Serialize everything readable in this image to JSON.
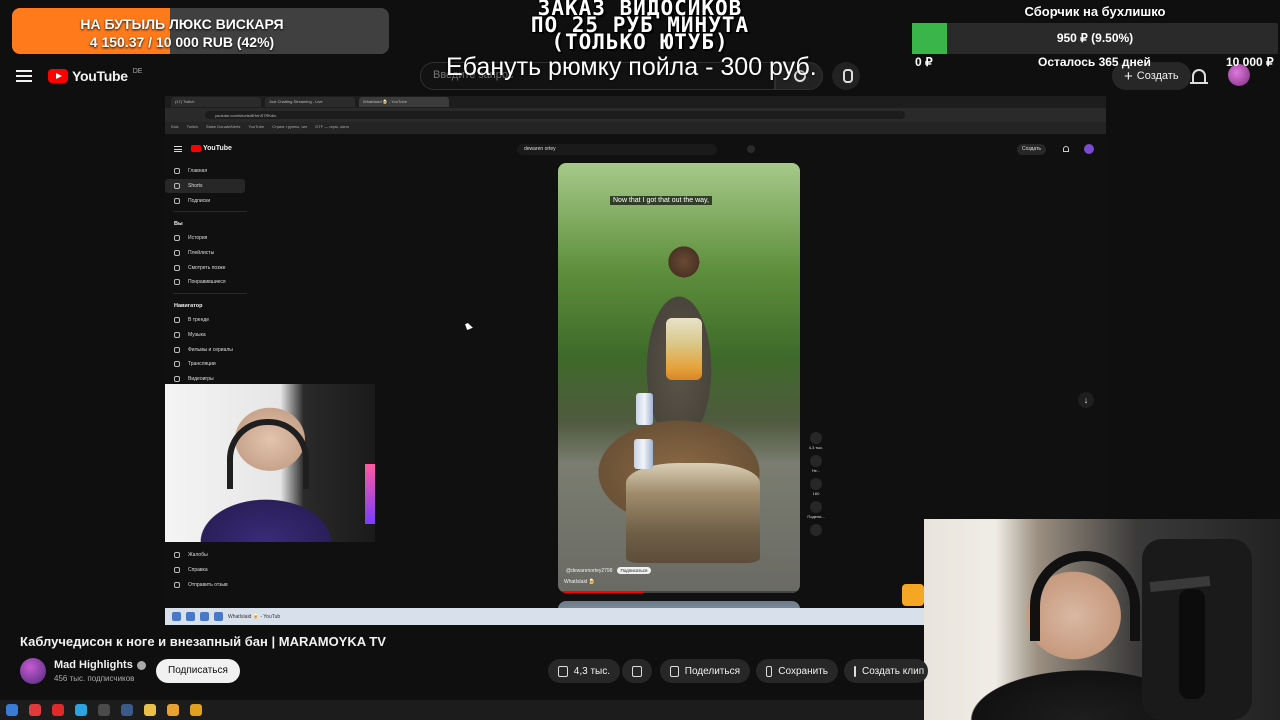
{
  "donation_goal": {
    "title": "НА БУТЫЛЬ ЛЮКС ВИСКАРЯ",
    "progress_text": "4 150.37 / 10 000 RUB (42%)",
    "progress": 0.42,
    "fill_color": "#ff7a1a"
  },
  "order_banner": {
    "lines": [
      "ЗАКАЗ ВИДОСИКОВ",
      "ПО 25 РУБ МИНУТА",
      "(ТОЛЬКО ЮТУБ)"
    ],
    "rumka_text": "Ебануть рюмку пойла - 300 руб."
  },
  "right_goal": {
    "title": "Сборчик на бухлишко",
    "amount": "950 ₽ (9.50%)",
    "progress": 0.095,
    "min": "0 ₽",
    "days_left": "Осталось 365 дней",
    "max": "10 000 ₽",
    "fill_color": "#3ab54a"
  },
  "header": {
    "logo_text": "YouTube",
    "logo_country": "DE",
    "search_placeholder": "Введите запрос",
    "create_label": "Создать"
  },
  "inner_browser": {
    "tabs": [
      "(17) Twitch",
      "Just Chatting Streaming - Live",
      "WhatIslaid 🍺 - YouTube"
    ],
    "url": "youtube.com/shorts/8HnhS7RKdtc",
    "bookmarks": [
      "Kick",
      "Twitch",
      "Stake DonateAlerts",
      "YouTube",
      "Стрим: группы, чат",
      "DTF — игры, кино"
    ],
    "logo_text": "YouTube",
    "search_value": "dewaren ortey",
    "create_label": "Создать",
    "sidebar": {
      "items_top": [
        "Главная",
        "Shorts",
        "Подписки"
      ],
      "you_heading": "Вы",
      "items_you": [
        "История",
        "Плейлисты",
        "Смотреть позже",
        "Понравившиеся"
      ],
      "nav_heading": "Навигатор",
      "items_nav": [
        "В тренде",
        "Музыка",
        "Фильмы и сериалы",
        "Трансляции",
        "Видеоигры"
      ],
      "items_bottom": [
        "Жалобы",
        "Справка",
        "Отправить отзыв"
      ]
    },
    "short": {
      "caption": "Now that I got that out the way,",
      "channel": "@dewarenortey2798",
      "subscribe": "Подписаться",
      "title": "WhatIslaid 🍺",
      "likes": "4,3 тыс.",
      "dislike": "Не...",
      "comments": "160",
      "share": "Подели..."
    },
    "taskbar_app": "WhatIslaid 🍺 - YouTub"
  },
  "video": {
    "title": "Каблучедисон к ноге и внезапный бан | MARAMOYKA TV",
    "channel_name": "Mad Highlights",
    "subscribers": "456 тыс. подписчиков",
    "subscribe_label": "Подписаться",
    "likes": "4,3 тыс.",
    "share_label": "Поделиться",
    "save_label": "Сохранить",
    "clip_label": "Создать клип"
  },
  "taskbar_icons": [
    "windows-icon",
    "yandex-icon",
    "opera-icon",
    "telegram-icon",
    "obs-icon",
    "steam-icon",
    "folder-icon",
    "winamp-icon",
    "chrome-icon"
  ],
  "taskbar_colors": [
    "#3a7bd5",
    "#e03a3a",
    "#e02a2a",
    "#2aa3e0",
    "#4a4a4a",
    "#3a5a8a",
    "#e8c04a",
    "#e8a030",
    "#e0a020"
  ]
}
